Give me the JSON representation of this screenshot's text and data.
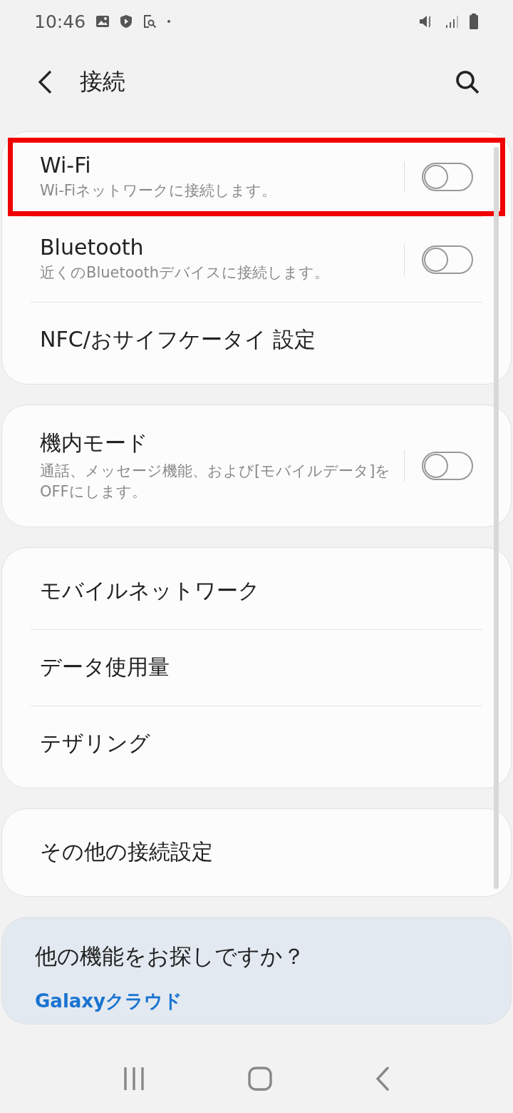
{
  "status_bar": {
    "time": "10:46"
  },
  "header": {
    "title": "接続"
  },
  "groups": [
    {
      "items": [
        {
          "kind": "toggle",
          "title": "Wi-Fi",
          "subtitle": "Wi-Fiネットワークに接続します。",
          "on": false,
          "highlighted": true
        },
        {
          "kind": "toggle",
          "title": "Bluetooth",
          "subtitle": "近くのBluetoothデバイスに接続します。",
          "on": false,
          "highlighted": false
        },
        {
          "kind": "plain",
          "title": "NFC/おサイフケータイ 設定",
          "highlighted": false
        }
      ]
    },
    {
      "items": [
        {
          "kind": "toggle",
          "title": "機内モード",
          "subtitle": "通話、メッセージ機能、および[モバイルデータ]をOFFにします。",
          "on": false,
          "highlighted": false
        }
      ]
    },
    {
      "items": [
        {
          "kind": "plain",
          "title": "モバイルネットワーク",
          "highlighted": false
        },
        {
          "kind": "plain",
          "title": "データ使用量",
          "highlighted": false
        },
        {
          "kind": "plain",
          "title": "テザリング",
          "highlighted": false
        }
      ]
    },
    {
      "items": [
        {
          "kind": "plain",
          "title": "その他の接続設定",
          "highlighted": false
        }
      ]
    }
  ],
  "suggestion": {
    "title": "他の機能をお探しですか？",
    "link": "Galaxyクラウド"
  }
}
